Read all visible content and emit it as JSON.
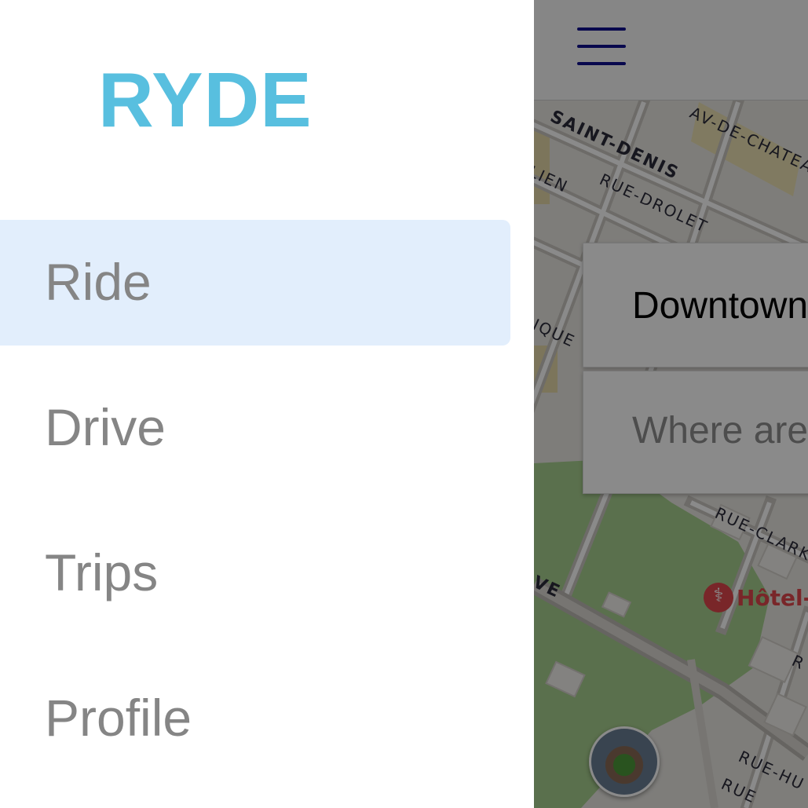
{
  "drawer": {
    "brand": "RYDE",
    "items": [
      {
        "label": "Ride",
        "active": true
      },
      {
        "label": "Drive",
        "active": false
      },
      {
        "label": "Trips",
        "active": false
      },
      {
        "label": "Profile",
        "active": false
      }
    ]
  },
  "map": {
    "header": {
      "menu_icon": "hamburger-icon"
    },
    "pickup": {
      "value": "Downtown"
    },
    "destination": {
      "placeholder": "Where are you going?"
    },
    "street_labels": {
      "s1": "SAINT-DENIS",
      "s2": "AV-DE-CHATEAU",
      "s3": "LIEN",
      "s4": "RUE-DROLET",
      "s5": "IQUE",
      "s6": "RUE-CLARK",
      "s7": "VE",
      "s8": "RUE-HU",
      "s9": "RUE",
      "s10": "R"
    },
    "poi": {
      "name": "Hôtel-",
      "icon": "hospital-icon"
    },
    "landmark_thumbnail": "stadium-thumbnail"
  },
  "colors": {
    "brand": "#58bfdf",
    "active_item_bg": "#e2eefc",
    "nav_text": "#858585",
    "menu_icon": "#10108f",
    "poi": "#e0474c"
  }
}
